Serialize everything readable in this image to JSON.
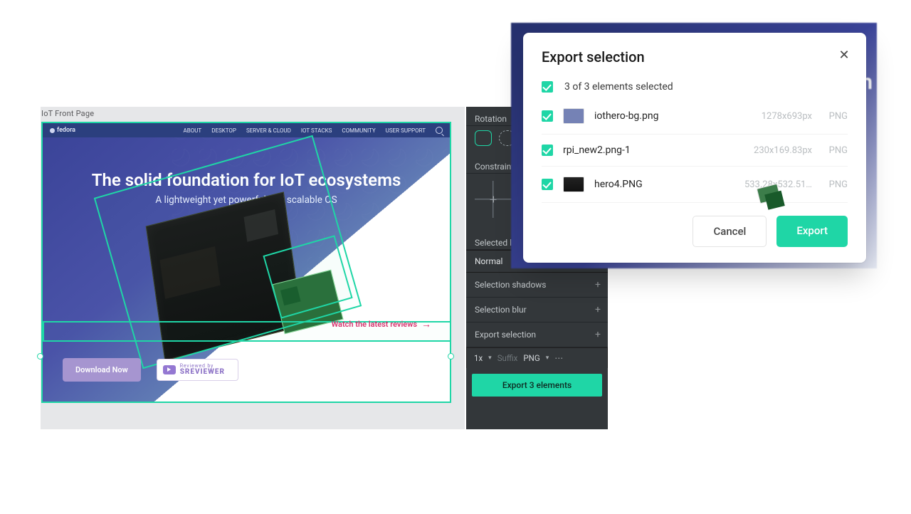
{
  "colors": {
    "accent": "#1fd6a6",
    "brand_purple": "#9478d2",
    "watch_pink": "#d7326e"
  },
  "canvas": {
    "tab": "IoT Front Page",
    "brand": "fedora",
    "nav": [
      "ABOUT",
      "DESKTOP",
      "SERVER & CLOUD",
      "IOT STACKS",
      "COMMUNITY",
      "USER SUPPORT"
    ],
    "headline": "The solid foundation for IoT ecosystems",
    "subhead": "A lightweight yet powerful and scalable OS",
    "watch_link": "Watch the latest reviews",
    "download_btn": "Download Now",
    "sreviewer": {
      "caption": "Reviewed by",
      "brand": "SREVIEWER"
    }
  },
  "inspector": {
    "rotation_label": "Rotation",
    "constraints_label": "Constraint",
    "selected_label": "Selected l",
    "blend_mode": "Normal",
    "shadows_label": "Selection shadows",
    "blur_label": "Selection blur",
    "export_label": "Export selection",
    "scale": "1x",
    "suffix_placeholder": "Suffix",
    "format": "PNG",
    "export_btn": "Export 3 elements"
  },
  "modal": {
    "title": "Export selection",
    "summary": "3 of 3 elements selected",
    "files": [
      {
        "name": "iothero-bg.png",
        "dim": "1278x693px",
        "fmt": "PNG"
      },
      {
        "name": "rpi_new2.png-1",
        "dim": "230x169.83px",
        "fmt": "PNG"
      },
      {
        "name": "hero4.PNG",
        "dim": "533.28x532.51…",
        "fmt": "PNG"
      }
    ],
    "cancel": "Cancel",
    "export": "Export"
  }
}
